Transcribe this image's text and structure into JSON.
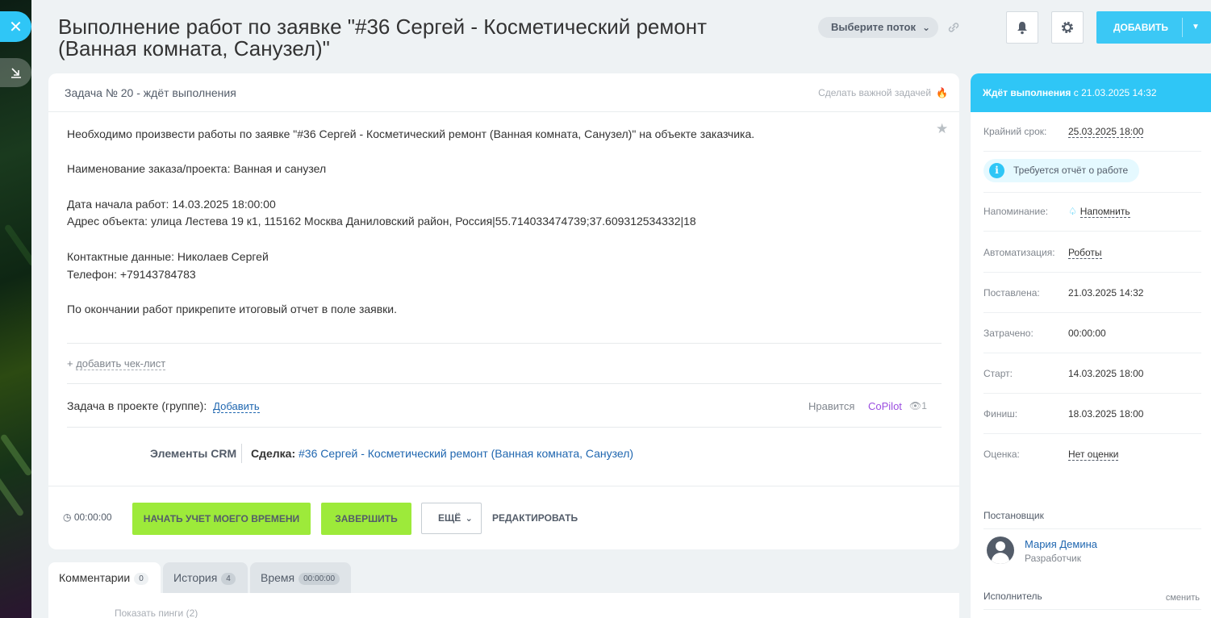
{
  "header": {
    "title": "Выполнение работ по заявке \"#36 Сергей - Косметический ремонт (Ванная комната, Санузел)\"",
    "flow_select": "Выберите поток",
    "add_button": "ДОБАВИТЬ"
  },
  "task": {
    "status": "Задача № 20 - ждёт выполнения",
    "make_important": "Сделать важной задачей",
    "description": [
      "Необходимо произвести работы по заявке \"#36 Сергей - Косметический ремонт (Ванная комната, Санузел)\" на объекте заказчика.",
      "",
      "Наименование заказа/проекта: Ванная и санузел",
      "",
      "Дата начала работ: 14.03.2025 18:00:00",
      "Адрес объекта: улица Лестева 19 к1, 115162 Москва Даниловский район, Россия|55.714033474739;37.609312534332|18",
      "",
      "Контактные данные: Николаев Сергей",
      "Телефон: +79143784783",
      "",
      "По окончании работ прикрепите итоговый отчет в поле заявки."
    ],
    "add_checklist_prefix": "+ ",
    "add_checklist": "добавить чек-лист",
    "project_label": "Задача в проекте (группе):",
    "project_add": "Добавить",
    "likes": "Нравится",
    "copilot": "CoPilot",
    "views": "1",
    "crm_label": "Элементы CRM",
    "deal_label": "Сделка:",
    "deal_link": "#36 Сергей - Косметический ремонт (Ванная комната, Санузел)"
  },
  "actions": {
    "timer": "00:00:00",
    "start_tracking": "НАЧАТЬ УЧЕТ МОЕГО ВРЕМЕНИ",
    "finish": "ЗАВЕРШИТЬ",
    "more": "ЕЩЁ",
    "edit": "РЕДАКТИРОВАТЬ"
  },
  "tabs": [
    {
      "label": "Комментарии",
      "count": "0"
    },
    {
      "label": "История",
      "count": "4"
    },
    {
      "label": "Время",
      "count": "00:00:00"
    }
  ],
  "comments": {
    "show_pings": "Показать пинги (2)"
  },
  "sidebar": {
    "status_bold": "Ждёт выполнения",
    "status_rest": " с 21.03.2025 14:32",
    "deadline_label": "Крайний срок:",
    "deadline_value": "25.03.2025 18:00",
    "report_required": "Требуется отчёт о работе",
    "reminder_label": "Напоминание:",
    "reminder_value": "Напомнить",
    "automation_label": "Автоматизация:",
    "automation_value": "Роботы",
    "created_label": "Поставлена:",
    "created_value": "21.03.2025 14:32",
    "spent_label": "Затрачено:",
    "spent_value": "00:00:00",
    "start_label": "Старт:",
    "start_value": "14.03.2025 18:00",
    "finish_label": "Финиш:",
    "finish_value": "18.03.2025 18:00",
    "rating_label": "Оценка:",
    "rating_value": "Нет оценки",
    "creator_title": "Постановщик",
    "creator_name": "Мария Демина",
    "creator_role": "Разработчик",
    "assignee_title": "Исполнитель",
    "change": "сменить"
  },
  "colors": {
    "accent": "#2fc6f6",
    "green_button": "#9dea3a",
    "link": "#2067b0",
    "copilot": "#9b4ee0"
  }
}
